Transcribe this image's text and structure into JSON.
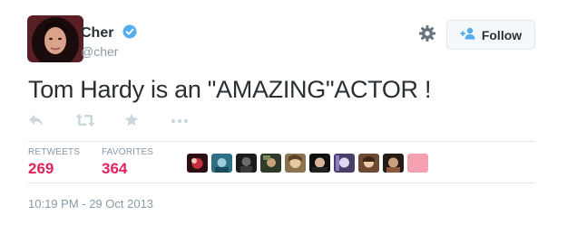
{
  "user": {
    "name": "Cher",
    "handle": "@cher"
  },
  "follow_button": {
    "label": "Follow"
  },
  "tweet": {
    "text": "Tom Hardy is an \"AMAZING\"ACTOR !"
  },
  "stats": {
    "retweets_label": "RETWEETS",
    "retweets_value": "269",
    "favorites_label": "FAVORITES",
    "favorites_value": "364"
  },
  "favoriters_count_shown": 10,
  "timestamp": "10:19 PM - 29 Oct 2013",
  "colors": {
    "accent": "#55acee",
    "stat_value": "#e0245e",
    "muted": "#8899a6",
    "text": "#292f33",
    "divider": "#e1e8ed",
    "action_icon": "#ccd6dd"
  },
  "icons": [
    "verified-badge-icon",
    "gear-icon",
    "follow-user-icon",
    "reply-icon",
    "retweet-icon",
    "favorite-star-icon",
    "more-dots-icon"
  ]
}
